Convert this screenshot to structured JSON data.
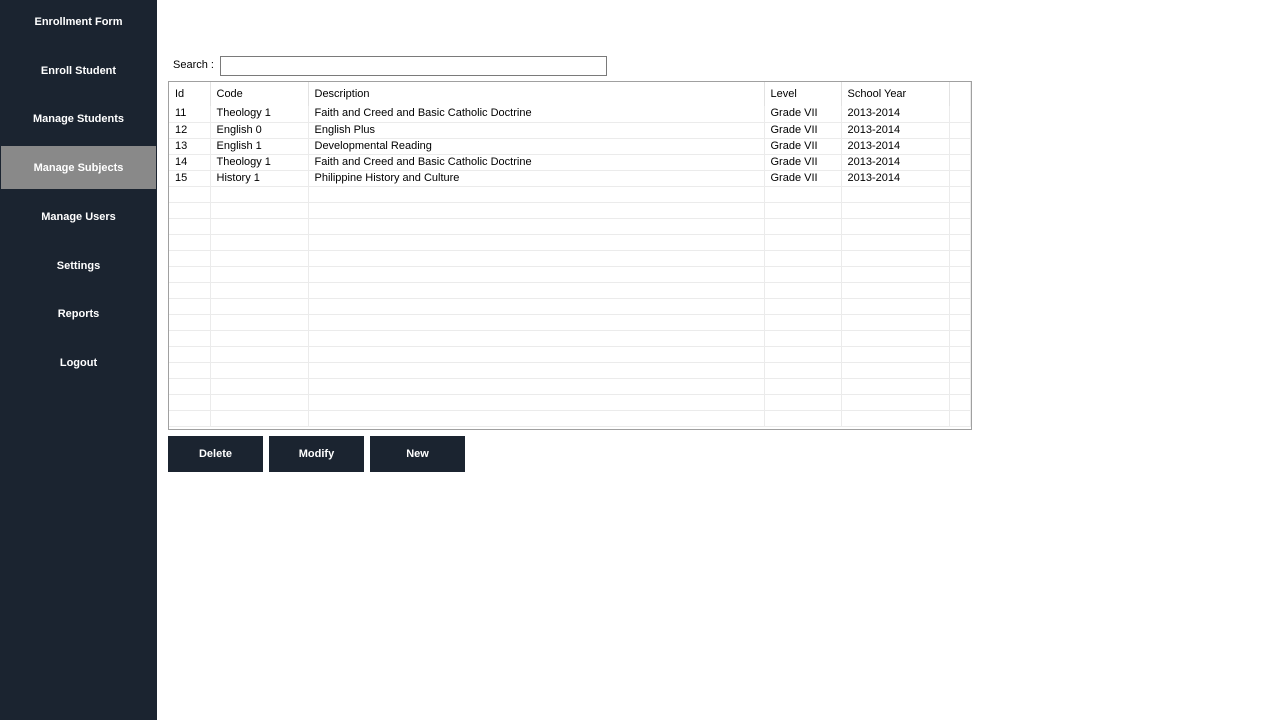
{
  "sidebar": {
    "items": [
      {
        "label": "Enrollment Form",
        "active": false
      },
      {
        "label": "Enroll Student",
        "active": false
      },
      {
        "label": "Manage Students",
        "active": false
      },
      {
        "label": "Manage Subjects",
        "active": true
      },
      {
        "label": "Manage Users",
        "active": false
      },
      {
        "label": "Settings",
        "active": false
      },
      {
        "label": "Reports",
        "active": false
      },
      {
        "label": "Logout",
        "active": false
      }
    ]
  },
  "search": {
    "label": "Search :",
    "value": ""
  },
  "grid": {
    "columns": [
      "Id",
      "Code",
      "Description",
      "Level",
      "School Year"
    ],
    "rows": [
      [
        "11",
        "Theology 1",
        "Faith and Creed and Basic Catholic Doctrine",
        "Grade VII",
        "2013-2014"
      ],
      [
        "12",
        "English 0",
        "English Plus",
        "Grade VII",
        "2013-2014"
      ],
      [
        "13",
        "English 1",
        "Developmental Reading",
        "Grade VII",
        "2013-2014"
      ],
      [
        "14",
        "Theology 1",
        "Faith and Creed and Basic Catholic Doctrine",
        "Grade VII",
        "2013-2014"
      ],
      [
        "15",
        "History 1",
        "Philippine History and Culture",
        "Grade VII",
        "2013-2014"
      ]
    ]
  },
  "buttons": {
    "delete_label": "Delete",
    "modify_label": "Modify",
    "new_label": "New"
  },
  "colors": {
    "sidebar_bg": "#1b2430",
    "active_item_bg": "#898989",
    "button_bg": "#1b2430"
  }
}
